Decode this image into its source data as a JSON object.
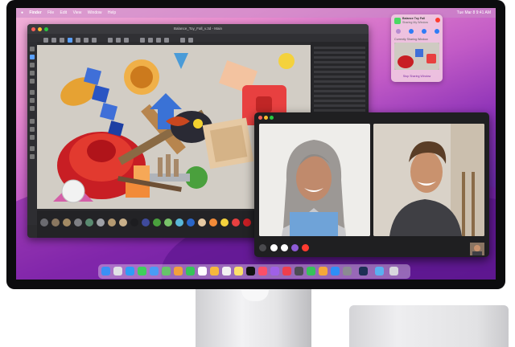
{
  "menubar": {
    "app_name": "Finder",
    "items": [
      "File",
      "Edit",
      "View",
      "Window",
      "Help"
    ],
    "clock": "Tue Mar 8  9:41 AM"
  },
  "app_window": {
    "title": "Balance_Toy_Fall_v.3d - Main"
  },
  "shareplay": {
    "title": "Balance Toy Fall",
    "subtitle": "Sharing My Window",
    "section": "Currently Sharing Window",
    "button": "Stop Sharing Window"
  },
  "colors": {
    "accent": "#8a2be2",
    "end_call": "#ff3b30"
  }
}
